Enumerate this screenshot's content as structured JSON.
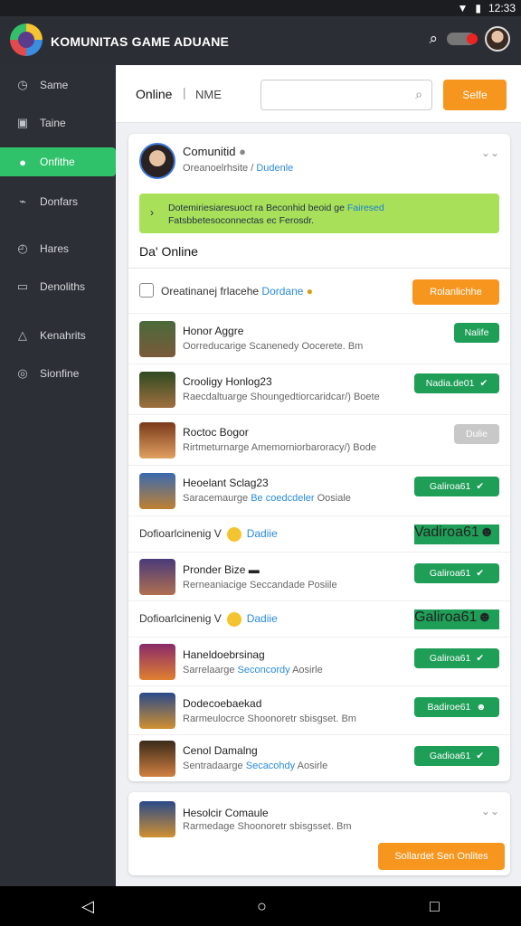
{
  "status": {
    "time": "12:33"
  },
  "app": {
    "title": "KOMUNITAS GAME ADUANE"
  },
  "sidebar": {
    "items": [
      {
        "label": "Same",
        "icon": "clock-icon"
      },
      {
        "label": "Taine",
        "icon": "calendar-icon"
      },
      {
        "label": "Onfithe",
        "icon": "user-icon"
      },
      {
        "label": "Donfars",
        "icon": "stats-icon"
      },
      {
        "label": "Hares",
        "icon": "clock-icon"
      },
      {
        "label": "Denoliths",
        "icon": "mail-icon"
      },
      {
        "label": "Kenahrits",
        "icon": "alert-icon"
      },
      {
        "label": "Sionfine",
        "icon": "settings-icon"
      }
    ]
  },
  "topbar": {
    "tab_label": "Online",
    "tab_name": "NME",
    "search_placeholder": "",
    "button_label": "Selfe"
  },
  "card": {
    "title": "Comunitid",
    "subtitle": "Oreanoelrhsite /",
    "subtitle_link": "Dudenle",
    "banner_line1": "Dotemiriesiaresuoct ra Beconhid beoid ge",
    "banner_line1_link": "Fairesed",
    "banner_line2": "Fatsbbetesoconnectas ec Ferosdr.",
    "section_title": "Da' Online",
    "header_text": "Oreatinanej frlacehe",
    "header_link": "Dordane",
    "header_button": "Rolanlichhe"
  },
  "rows": [
    {
      "name": "Honor Aggre",
      "desc": "Oorreducarige Scanenedy Oocerete. Bm",
      "btn": "Nalife",
      "btn_style": "green"
    },
    {
      "name": "Crooligy Honlog23",
      "desc": "Raecdaltuarge Shoungedtiorcaridcar/) Boete",
      "btn": "Nadia.de01",
      "btn_style": "green"
    },
    {
      "name": "Roctoc Bogor",
      "desc": "Rirtmeturnarge Amemorniorbaroracy/) Bode",
      "btn": "Dulie",
      "btn_style": "gray"
    },
    {
      "name": "Heoelant Sclag23",
      "desc": "Saracemaurge",
      "desc_link": "Be coedcdeler",
      "desc_tail": "Oosiale",
      "btn": "Galiroa61",
      "btn_style": "green"
    },
    {
      "name": "Pronder Bize",
      "desc": "Rerneaniacige Seccandade",
      "desc_tail": "Posiile",
      "btn": "Galiroa61",
      "btn_style": "green"
    },
    {
      "name": "Haneldoebrsinag",
      "desc": "Sarrelaarge",
      "desc_link": "Seconcordy",
      "desc_tail": "Aosirle",
      "btn": "Galiroa61",
      "btn_style": "green"
    },
    {
      "name": "Dodecoebaekad",
      "desc": "Rarmeulocrce Shoonoretr sbisgset. Bm",
      "btn": "Badiroe61",
      "btn_style": "green"
    },
    {
      "name": "Cenol Damalng",
      "desc": "Sentradaarge",
      "desc_link": "Secacohdy",
      "desc_tail": "Aosirle",
      "btn": "Gadioa61",
      "btn_style": "green"
    }
  ],
  "subrows": [
    {
      "text": "Dofioarlcinenig V",
      "link": "Dadiie",
      "btn": "Vadiroa61"
    },
    {
      "text": "Dofioarlcinenig V",
      "link": "Dadiie",
      "btn": "Galiroa61"
    }
  ],
  "card2": {
    "name": "Hesolcir Comaule",
    "desc": "Rarmedage Shoonoretr sbisgsset. Bm",
    "btn": "Sollardet Sen Onlites"
  }
}
